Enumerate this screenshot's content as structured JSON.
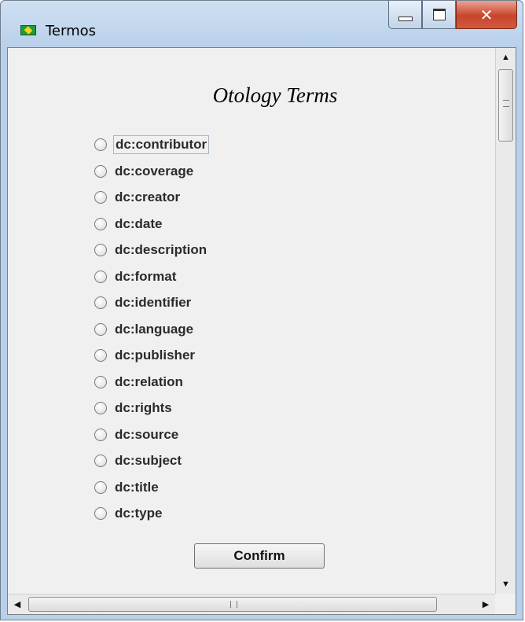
{
  "window": {
    "title": "Termos",
    "icon": "brazil-flag-icon",
    "controls": {
      "minimize": "minimize-icon",
      "maximize": "maximize-icon",
      "close": "✕"
    }
  },
  "heading": "Otology Terms",
  "options": [
    {
      "label": "dc:contributor",
      "focused": true
    },
    {
      "label": "dc:coverage"
    },
    {
      "label": "dc:creator"
    },
    {
      "label": "dc:date"
    },
    {
      "label": "dc:description"
    },
    {
      "label": "dc:format"
    },
    {
      "label": "dc:identifier"
    },
    {
      "label": "dc:language"
    },
    {
      "label": "dc:publisher"
    },
    {
      "label": "dc:relation"
    },
    {
      "label": "dc:rights"
    },
    {
      "label": "dc:source"
    },
    {
      "label": "dc:subject"
    },
    {
      "label": "dc:title"
    },
    {
      "label": "dc:type"
    }
  ],
  "confirm_label": "Confirm",
  "scrollbars": {
    "vertical": {
      "up": "▲",
      "down": "▼"
    },
    "horizontal": {
      "left": "◀",
      "right": "▶"
    }
  },
  "colors": {
    "close_button": "#c7452b",
    "client_bg": "#f0f0f0",
    "title_bar": "#cfe0f2"
  }
}
